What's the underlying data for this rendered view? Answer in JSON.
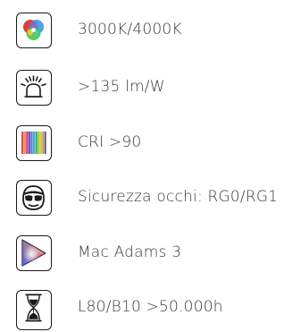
{
  "specs": [
    {
      "icon": "rgb-color-icon",
      "text": "3000K/4000K"
    },
    {
      "icon": "light-bulb-icon",
      "text": ">135 lm/W"
    },
    {
      "icon": "color-bars-icon",
      "text": "CRI >90"
    },
    {
      "icon": "safety-goggles-face-icon",
      "text": "Sicurezza occhi: RG0/RG1"
    },
    {
      "icon": "color-gamut-icon",
      "text": "Mac Adams 3"
    },
    {
      "icon": "hourglass-icon",
      "text": "L80/B10 >50.000h"
    }
  ],
  "colors": {
    "icon_stroke": "#1a1a1a",
    "text": "#3a3a3a",
    "background": "#ffffff"
  }
}
